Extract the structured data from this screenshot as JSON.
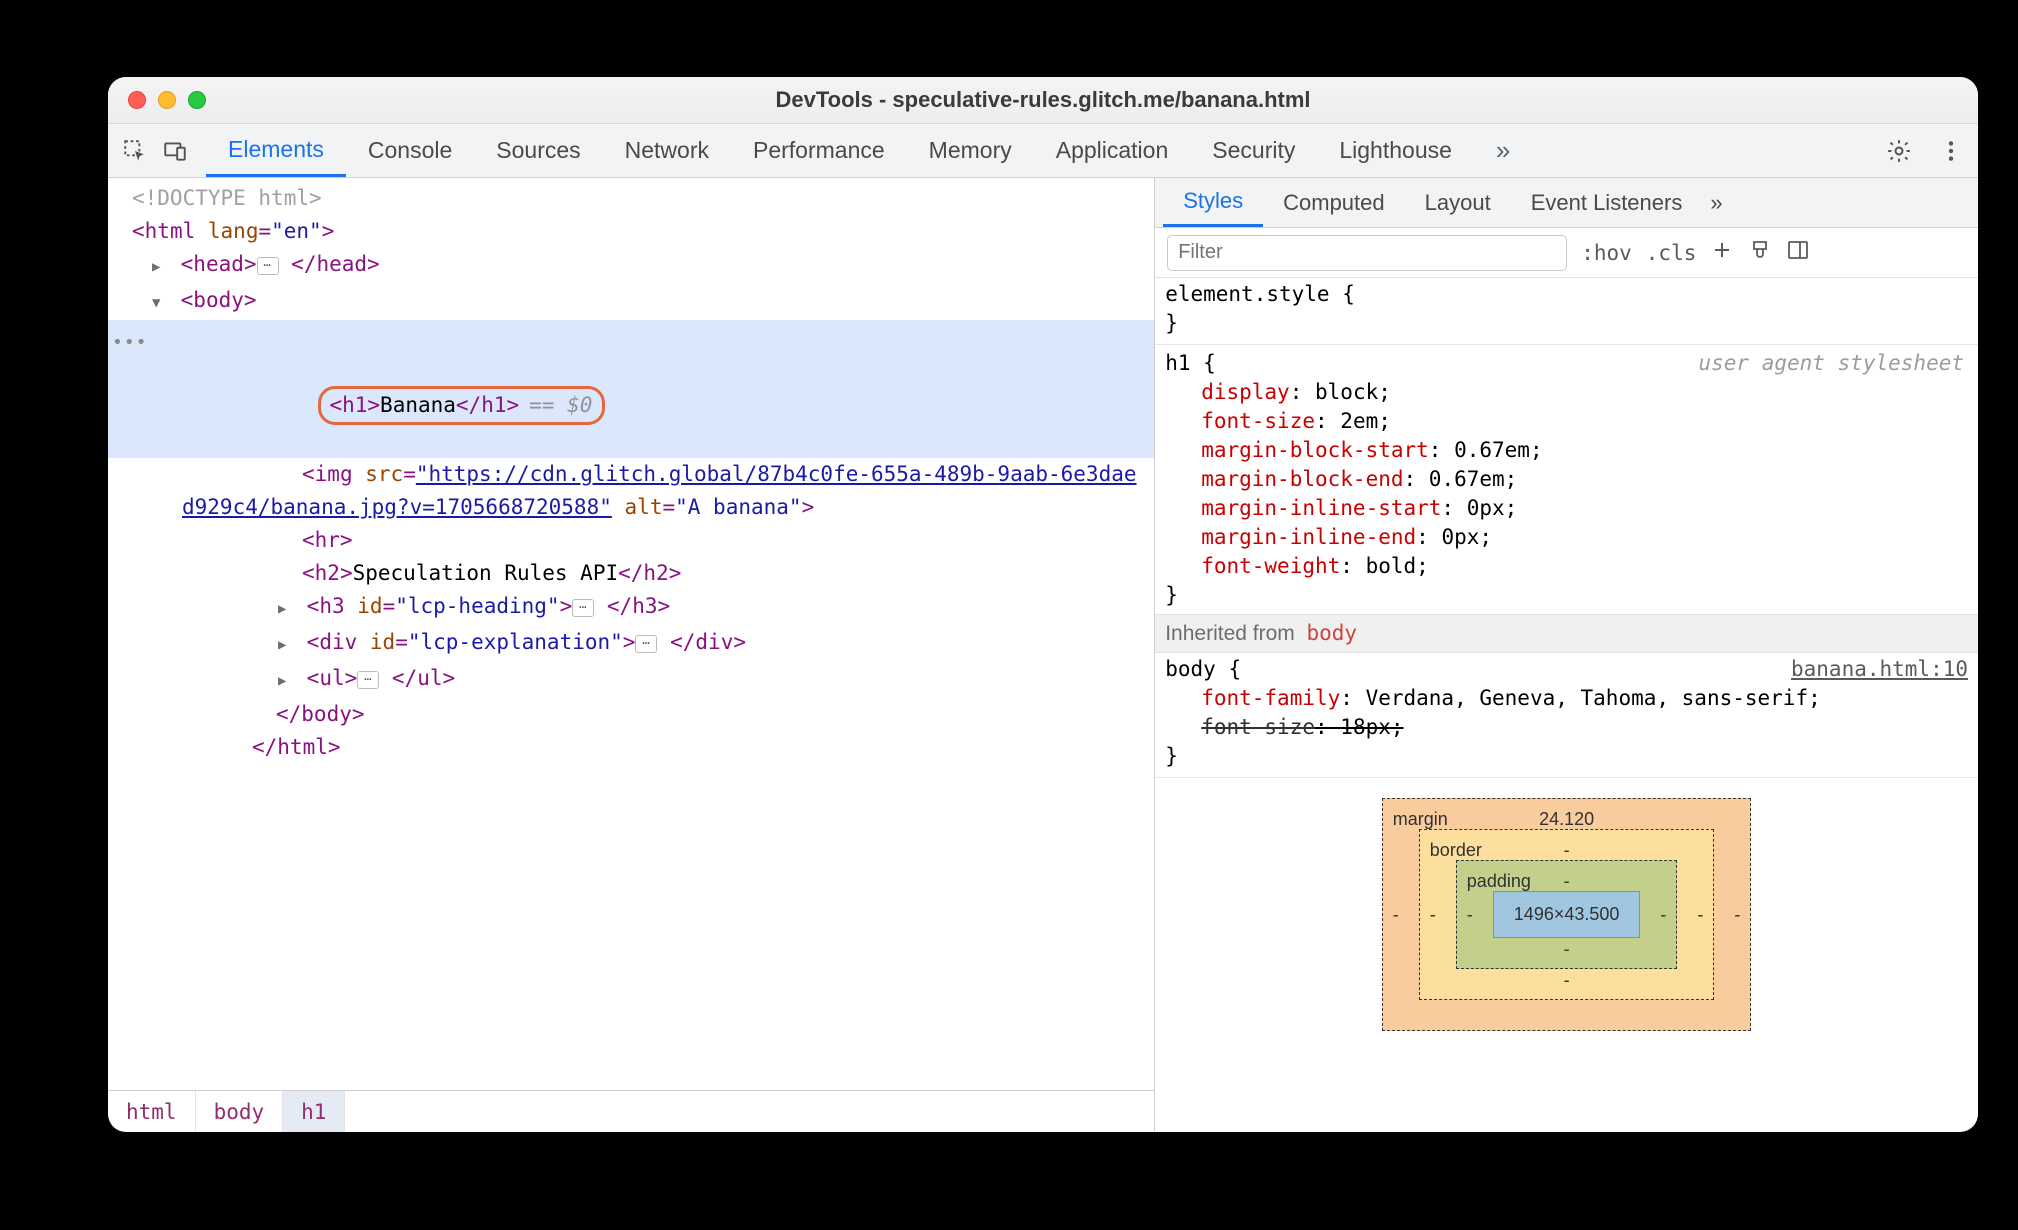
{
  "window": {
    "title": "DevTools - speculative-rules.glitch.me/banana.html"
  },
  "main_tabs": {
    "items": [
      "Elements",
      "Console",
      "Sources",
      "Network",
      "Performance",
      "Memory",
      "Application",
      "Security",
      "Lighthouse"
    ],
    "active_index": 0,
    "overflow_glyph": "»"
  },
  "dom": {
    "doctype": "<!DOCTYPE html>",
    "html_open": {
      "tag": "html",
      "attr_name": "lang",
      "attr_value": "\"en\""
    },
    "head_collapsed": {
      "open": "<head>",
      "close": "</head>"
    },
    "body_open": "<body>",
    "selected": {
      "markup": "<h1>Banana</h1>",
      "open_tag": "h1",
      "text": "Banana",
      "close_tag": "h1",
      "suffix": "== $0"
    },
    "img": {
      "tag": "img",
      "attr1_name": "src",
      "attr1_value": "\"https://cdn.glitch.global/87b4c0fe-655a-489b-9aab-6e3daed929c4/banana.jpg?v=1705668720588\"",
      "attr2_name": "alt",
      "attr2_value": "\"A banana\""
    },
    "hr": "<hr>",
    "h2": {
      "open_tag": "h2",
      "text": "Speculation Rules API",
      "close_tag": "h2"
    },
    "h3": {
      "tag": "h3",
      "attr_name": "id",
      "attr_value": "\"lcp-heading\""
    },
    "div": {
      "tag": "div",
      "attr_name": "id",
      "attr_value": "\"lcp-explanation\""
    },
    "ul": {
      "tag": "ul"
    },
    "body_close": "</body>",
    "html_close": "</html>"
  },
  "breadcrumb": {
    "items": [
      "html",
      "body",
      "h1"
    ],
    "active_index": 2
  },
  "sub_tabs": {
    "items": [
      "Styles",
      "Computed",
      "Layout",
      "Event Listeners"
    ],
    "active_index": 0,
    "overflow_glyph": "»"
  },
  "styles_toolbar": {
    "filter_placeholder": "Filter",
    "hov": ":hov",
    "cls": ".cls"
  },
  "styles": {
    "element_style": {
      "selector": "element.style",
      "open": "{",
      "close": "}"
    },
    "h1_rule": {
      "selector": "h1",
      "ua_label": "user agent stylesheet",
      "props": [
        {
          "name": "display",
          "value": "block"
        },
        {
          "name": "font-size",
          "value": "2em"
        },
        {
          "name": "margin-block-start",
          "value": "0.67em"
        },
        {
          "name": "margin-block-end",
          "value": "0.67em"
        },
        {
          "name": "margin-inline-start",
          "value": "0px"
        },
        {
          "name": "margin-inline-end",
          "value": "0px"
        },
        {
          "name": "font-weight",
          "value": "bold"
        }
      ]
    },
    "inherited_label": "Inherited from",
    "inherited_from": "body",
    "body_rule": {
      "selector": "body",
      "source": "banana.html:10",
      "props": [
        {
          "name": "font-family",
          "value": "Verdana, Geneva, Tahoma, sans-serif",
          "strike": false
        },
        {
          "name": "font-size",
          "value": "18px",
          "strike": true
        }
      ]
    }
  },
  "box_model": {
    "margin_label": "margin",
    "margin_top": "24.120",
    "border_label": "border",
    "border_top": "-",
    "padding_label": "padding",
    "padding_top": "-",
    "content": "1496×43.500",
    "dash": "-"
  },
  "glyphs": {
    "open_brace": "{",
    "close_brace": "}",
    "ellipsis": "⋯",
    "gutter": "•••"
  }
}
